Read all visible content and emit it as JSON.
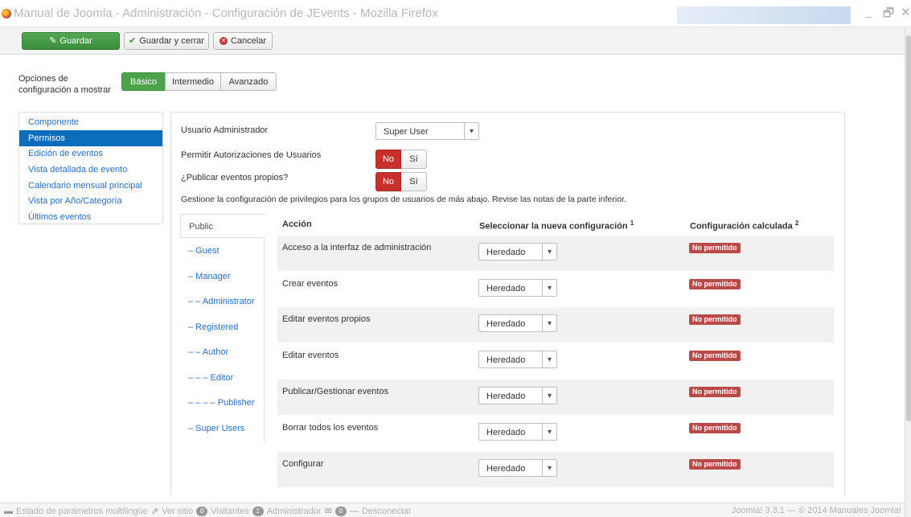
{
  "window": {
    "title": "Manual de Joomla - Administración - Configuración de JEvents - Mozilla Firefox",
    "minimize": "_",
    "maximize": "🗗",
    "close": "✕"
  },
  "toolbar": {
    "save_label": "Guardar",
    "save_close_label": "Guardar y cerrar",
    "cancel_label": "Cancelar"
  },
  "options": {
    "label": "Opciones de configuración a mostrar",
    "basic": "Básico",
    "intermediate": "Intermedio",
    "advanced": "Avanzado"
  },
  "sidebar": {
    "items": [
      {
        "label": "Componente",
        "active": false
      },
      {
        "label": "Permisos",
        "active": true
      },
      {
        "label": "Edición de eventos",
        "active": false
      },
      {
        "label": "Vista detallada de evento",
        "active": false
      },
      {
        "label": "Calendario mensual principal",
        "active": false
      },
      {
        "label": "Vista por Año/Categoría",
        "active": false
      },
      {
        "label": "Últimos eventos",
        "active": false
      }
    ]
  },
  "form": {
    "admin_user_label": "Usuario Administrador",
    "admin_user_value": "Super User",
    "allow_user_auth_label": "Permitir Autorizaciones de Usuarios",
    "publish_own_label": "¿Publicar eventos propios?",
    "no": "No",
    "yes": "Sí",
    "description": "Gestione la configuración de privilegios para los grupos de usuarios de más abajo. Revise las notas de la parte inferior."
  },
  "groups": [
    "Public",
    "– Guest",
    "– Manager",
    "– – Administrator",
    "– Registered",
    "– – Author",
    "– – – Editor",
    "– – – – Publisher",
    "– Super Users"
  ],
  "table": {
    "col_action": "Acción",
    "col_new_setting": "Seleccionar la nueva configuración",
    "col_new_setting_note": "1",
    "col_calculated": "Configuración calculada",
    "col_calculated_note": "2",
    "select_value": "Heredado",
    "badge_text": "No permitido",
    "rows": [
      "Acceso a la interfaz de administración",
      "Crear eventos",
      "Editar eventos propios",
      "Editar eventos",
      "Publicar/Gestionar eventos",
      "Borrar todos los eventos",
      "Configurar"
    ]
  },
  "statusbar": {
    "multilang": "Estado de parámetros multilingüe",
    "view_site": "Ver sitio",
    "visitors_count": "0",
    "visitors_label": "Visitantes",
    "admins_count": "1",
    "admins_label": "Administrador",
    "messages_count": "0",
    "logout": "Desconectar",
    "version": "Joomla! 3.3.1 — © 2014 Manuales Joomla!"
  },
  "colors": {
    "accent_blue": "#0a6ebd",
    "green": "#4ca34c",
    "red": "#c9302c",
    "badge_red": "#b94a48"
  }
}
